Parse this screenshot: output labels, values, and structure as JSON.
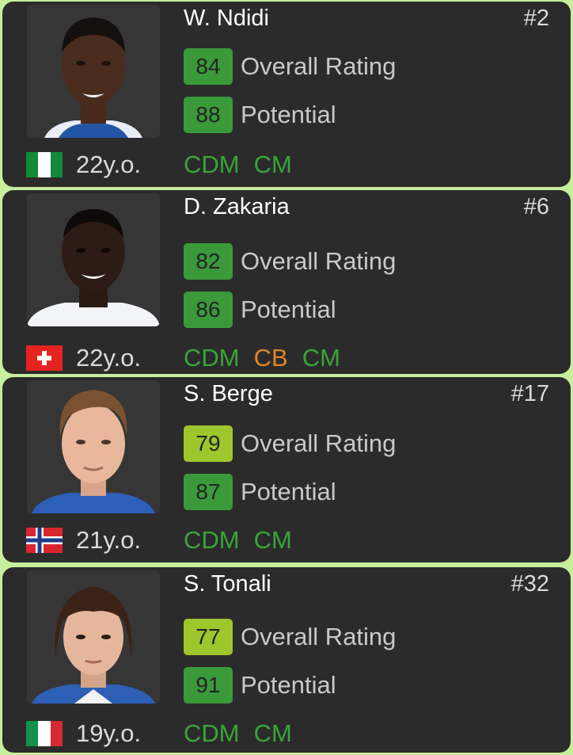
{
  "colors": {
    "badge_green": "#3a9a3a",
    "badge_lime": "#9dc72c",
    "position_green": "#3aa43a",
    "position_orange": "#e0852b",
    "card_bg": "#2b2b2b",
    "page_bg": "#c7ee9c"
  },
  "players": [
    {
      "name": "W. Ndidi",
      "number": "#2",
      "overall": "84",
      "overall_label": "Overall Rating",
      "overall_color": "#3a9a3a",
      "potential": "88",
      "potential_label": "Potential",
      "potential_color": "#3a9a3a",
      "age": "22y.o.",
      "flag": "nigeria-flag",
      "positions": [
        {
          "code": "CDM",
          "color": "#3aa43a"
        },
        {
          "code": "CM",
          "color": "#3aa43a"
        }
      ]
    },
    {
      "name": "D. Zakaria",
      "number": "#6",
      "overall": "82",
      "overall_label": "Overall Rating",
      "overall_color": "#3a9a3a",
      "potential": "86",
      "potential_label": "Potential",
      "potential_color": "#3a9a3a",
      "age": "22y.o.",
      "flag": "switzerland-flag",
      "positions": [
        {
          "code": "CDM",
          "color": "#3aa43a"
        },
        {
          "code": "CB",
          "color": "#e0852b"
        },
        {
          "code": "CM",
          "color": "#3aa43a"
        }
      ]
    },
    {
      "name": "S. Berge",
      "number": "#17",
      "overall": "79",
      "overall_label": "Overall Rating",
      "overall_color": "#9dc72c",
      "potential": "87",
      "potential_label": "Potential",
      "potential_color": "#3a9a3a",
      "age": "21y.o.",
      "flag": "norway-flag",
      "positions": [
        {
          "code": "CDM",
          "color": "#3aa43a"
        },
        {
          "code": "CM",
          "color": "#3aa43a"
        }
      ]
    },
    {
      "name": "S. Tonali",
      "number": "#32",
      "overall": "77",
      "overall_label": "Overall Rating",
      "overall_color": "#9dc72c",
      "potential": "91",
      "potential_label": "Potential",
      "potential_color": "#3a9a3a",
      "age": "19y.o.",
      "flag": "italy-flag",
      "positions": [
        {
          "code": "CDM",
          "color": "#3aa43a"
        },
        {
          "code": "CM",
          "color": "#3aa43a"
        }
      ]
    }
  ]
}
